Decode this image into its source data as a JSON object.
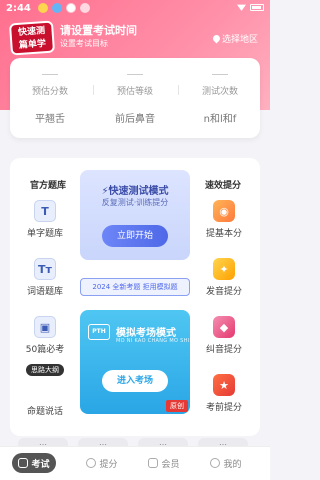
{
  "status_bar": {
    "time": "2:44"
  },
  "header": {
    "logo_line1": "快速测",
    "logo_line2": "篇单学",
    "exam_title": "请设置考试时间",
    "exam_subtitle": "设置考试目标",
    "region_label": "选择地区"
  },
  "stats": {
    "items": [
      {
        "label": "预估分数"
      },
      {
        "label": "预估等级"
      },
      {
        "label": "测试次数"
      }
    ],
    "tags": [
      "平翘舌",
      "前后鼻音",
      "n和l和f"
    ]
  },
  "left_column": {
    "title": "官方题库",
    "items": [
      {
        "label": "单字题库",
        "glyph": "T"
      },
      {
        "label": "词语题库",
        "glyph": "Tт"
      },
      {
        "label": "50篇必考",
        "glyph": "▣"
      },
      {
        "label": "命题说话",
        "glyph": "▤"
      }
    ],
    "tooltip": "思路大纲"
  },
  "right_column": {
    "title": "速效提分",
    "items": [
      {
        "label": "提基本分"
      },
      {
        "label": "发音提分"
      },
      {
        "label": "纠音提分"
      },
      {
        "label": "考前提分"
      }
    ]
  },
  "quick_test": {
    "title": "快速测试模式",
    "subtitle": "反复测试·训练提分",
    "button": "立即开始"
  },
  "mid_banner": "2024 全新考题 拒用模拟题",
  "mock_exam": {
    "logo": "PTH",
    "title": "模拟考场模式",
    "subtitle": "MO NI KAO CHANG MO SHI",
    "button": "进入考场",
    "badge": "原创"
  },
  "chips": [
    "…",
    "…",
    "…",
    "…"
  ],
  "nav": {
    "items": [
      {
        "label": "考试"
      },
      {
        "label": "提分"
      },
      {
        "label": "会员"
      },
      {
        "label": "我的"
      }
    ]
  },
  "colors": {
    "brand": "#ff6f8e",
    "accent_blue": "#4e68e8",
    "mock_blue": "#2aa6e6"
  }
}
